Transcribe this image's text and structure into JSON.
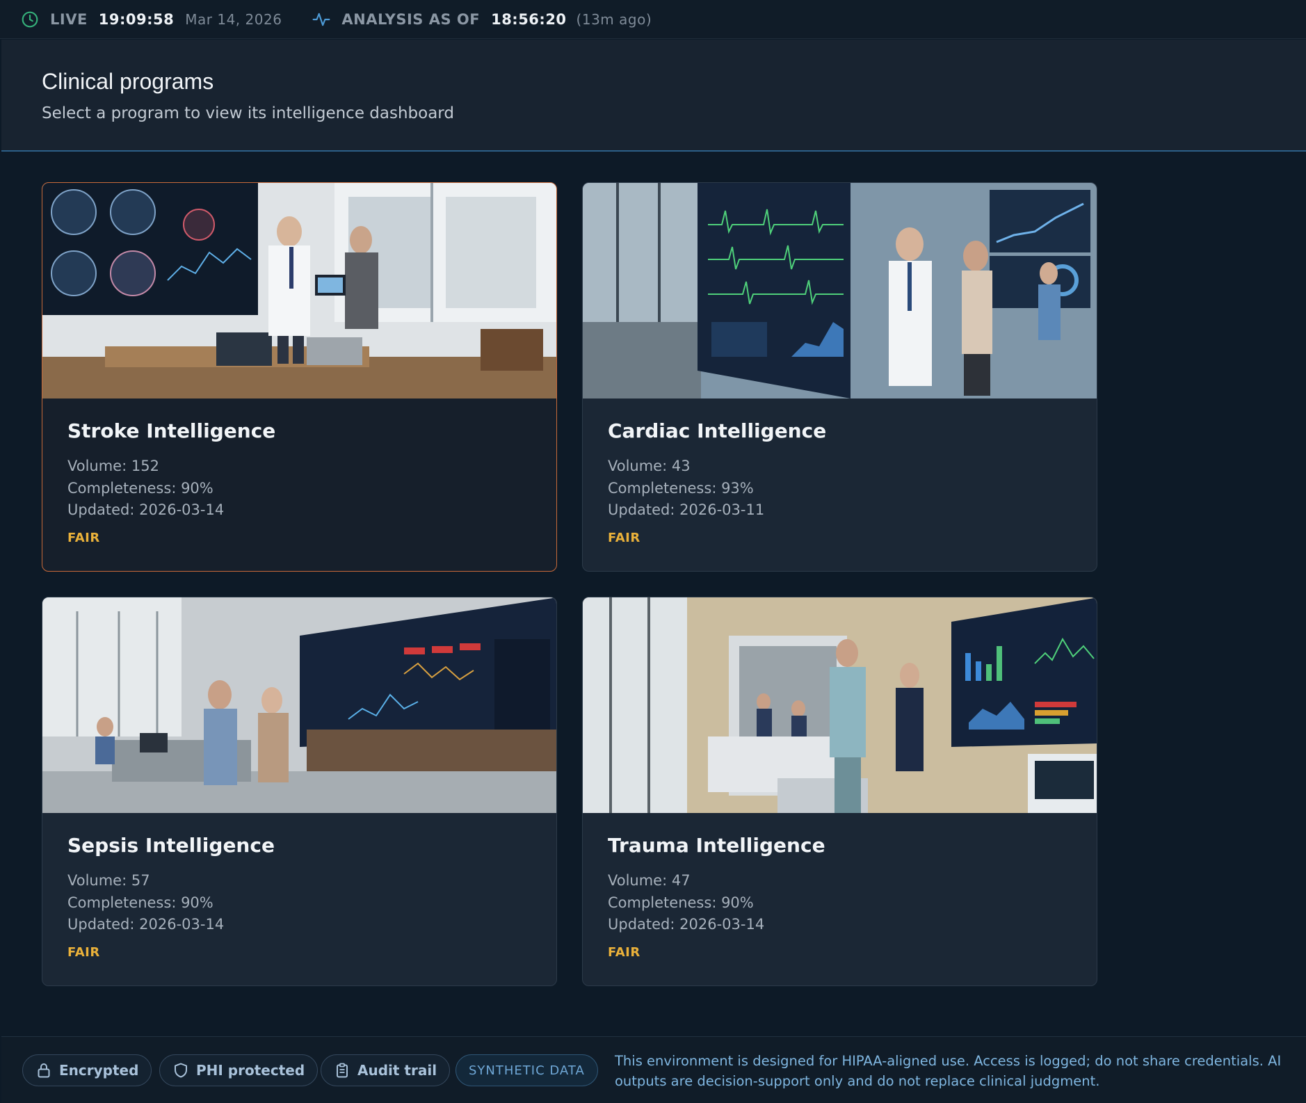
{
  "status": {
    "live_label": "LIVE",
    "live_time": "19:09:58",
    "live_date": "Mar 14, 2026",
    "analysis_label": "ANALYSIS AS OF",
    "analysis_time": "18:56:20",
    "analysis_ago": "(13m ago)"
  },
  "header": {
    "title": "Clinical programs",
    "subtitle": "Select a program to view its intelligence dashboard"
  },
  "programs": [
    {
      "name": "Stroke Intelligence",
      "volume": "Volume: 152",
      "completeness": "Completeness: 90%",
      "updated": "Updated: 2026-03-14",
      "rating": "FAIR",
      "selected": true,
      "photo_icon": "stroke-team-photo"
    },
    {
      "name": "Cardiac Intelligence",
      "volume": "Volume: 43",
      "completeness": "Completeness: 93%",
      "updated": "Updated: 2026-03-11",
      "rating": "FAIR",
      "selected": false,
      "photo_icon": "cardiac-team-photo"
    },
    {
      "name": "Sepsis Intelligence",
      "volume": "Volume: 57",
      "completeness": "Completeness: 90%",
      "updated": "Updated: 2026-03-14",
      "rating": "FAIR",
      "selected": false,
      "photo_icon": "sepsis-team-photo"
    },
    {
      "name": "Trauma Intelligence",
      "volume": "Volume: 47",
      "completeness": "Completeness: 90%",
      "updated": "Updated: 2026-03-14",
      "rating": "FAIR",
      "selected": false,
      "photo_icon": "trauma-team-photo"
    }
  ],
  "footer": {
    "badges": [
      {
        "label": "Encrypted",
        "icon": "lock-icon"
      },
      {
        "label": "PHI protected",
        "icon": "shield-icon"
      },
      {
        "label": "Audit trail",
        "icon": "clipboard-icon"
      }
    ],
    "synthetic_label": "SYNTHETIC DATA",
    "disclaimer": "This environment is designed for HIPAA-aligned use. Access is logged; do not share credentials. AI outputs are decision-support only and do not replace clinical judgment."
  },
  "colors": {
    "background": "#0d1a27",
    "card": "#1b2735",
    "selected_border": "#c86a3a",
    "rating": "#eab13a",
    "accent_blue": "#4d9ad6"
  }
}
